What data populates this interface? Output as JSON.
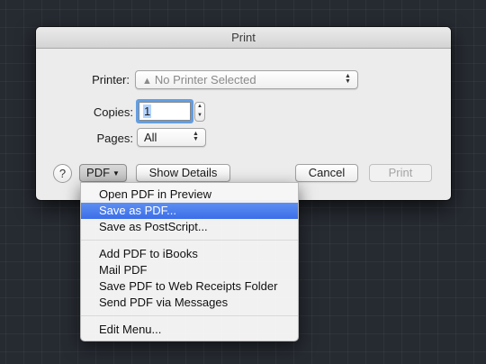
{
  "dialog": {
    "title": "Print",
    "printer_label": "Printer:",
    "printer_value": "No Printer Selected",
    "copies_label": "Copies:",
    "copies_value": "1",
    "pages_label": "Pages:",
    "pages_value": "All",
    "help_label": "?",
    "pdf_label": "PDF",
    "show_details_label": "Show Details",
    "cancel_label": "Cancel",
    "print_label": "Print"
  },
  "pdf_menu": {
    "groups": [
      [
        "Open PDF in Preview",
        "Save as PDF...",
        "Save as PostScript..."
      ],
      [
        "Add PDF to iBooks",
        "Mail PDF",
        "Save PDF to Web Receipts Folder",
        "Send PDF via Messages"
      ],
      [
        "Edit Menu..."
      ]
    ],
    "highlighted": "Save as PDF..."
  },
  "colors": {
    "menu_highlight": "#3b6ee8",
    "focus_ring": "#4a90e2",
    "background": "#262a31"
  }
}
